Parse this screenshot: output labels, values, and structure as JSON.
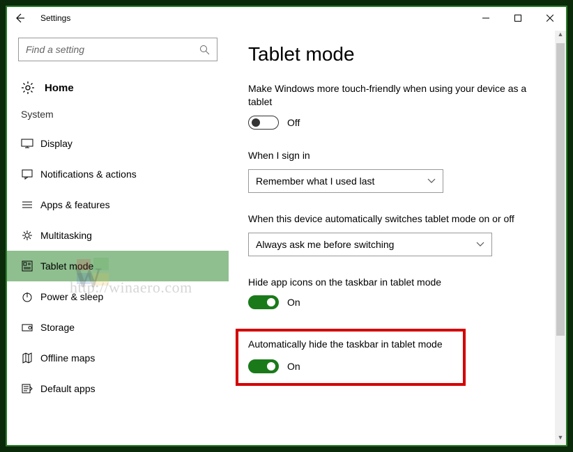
{
  "window": {
    "title": "Settings"
  },
  "sidebar": {
    "search_placeholder": "Find a setting",
    "home_label": "Home",
    "section_label": "System",
    "items": [
      {
        "label": "Display",
        "icon": "display-icon"
      },
      {
        "label": "Notifications & actions",
        "icon": "notifications-icon"
      },
      {
        "label": "Apps & features",
        "icon": "apps-icon"
      },
      {
        "label": "Multitasking",
        "icon": "multitasking-icon"
      },
      {
        "label": "Tablet mode",
        "icon": "tablet-icon"
      },
      {
        "label": "Power & sleep",
        "icon": "power-icon"
      },
      {
        "label": "Storage",
        "icon": "storage-icon"
      },
      {
        "label": "Offline maps",
        "icon": "maps-icon"
      },
      {
        "label": "Default apps",
        "icon": "default-apps-icon"
      }
    ],
    "selected_index": 4
  },
  "content": {
    "title": "Tablet mode",
    "toggle_touch": {
      "label": "Make Windows more touch-friendly when using your device as a tablet",
      "state": "Off",
      "on": false
    },
    "signin": {
      "label": "When I sign in",
      "value": "Remember what I used last"
    },
    "switch": {
      "label": "When this device automatically switches tablet mode on or off",
      "value": "Always ask me before switching"
    },
    "hide_icons": {
      "label": "Hide app icons on the taskbar in tablet mode",
      "state": "On",
      "on": true
    },
    "hide_taskbar": {
      "label": "Automatically hide the taskbar in tablet mode",
      "state": "On",
      "on": true
    }
  },
  "watermark": {
    "text": "http://winaero.com"
  }
}
